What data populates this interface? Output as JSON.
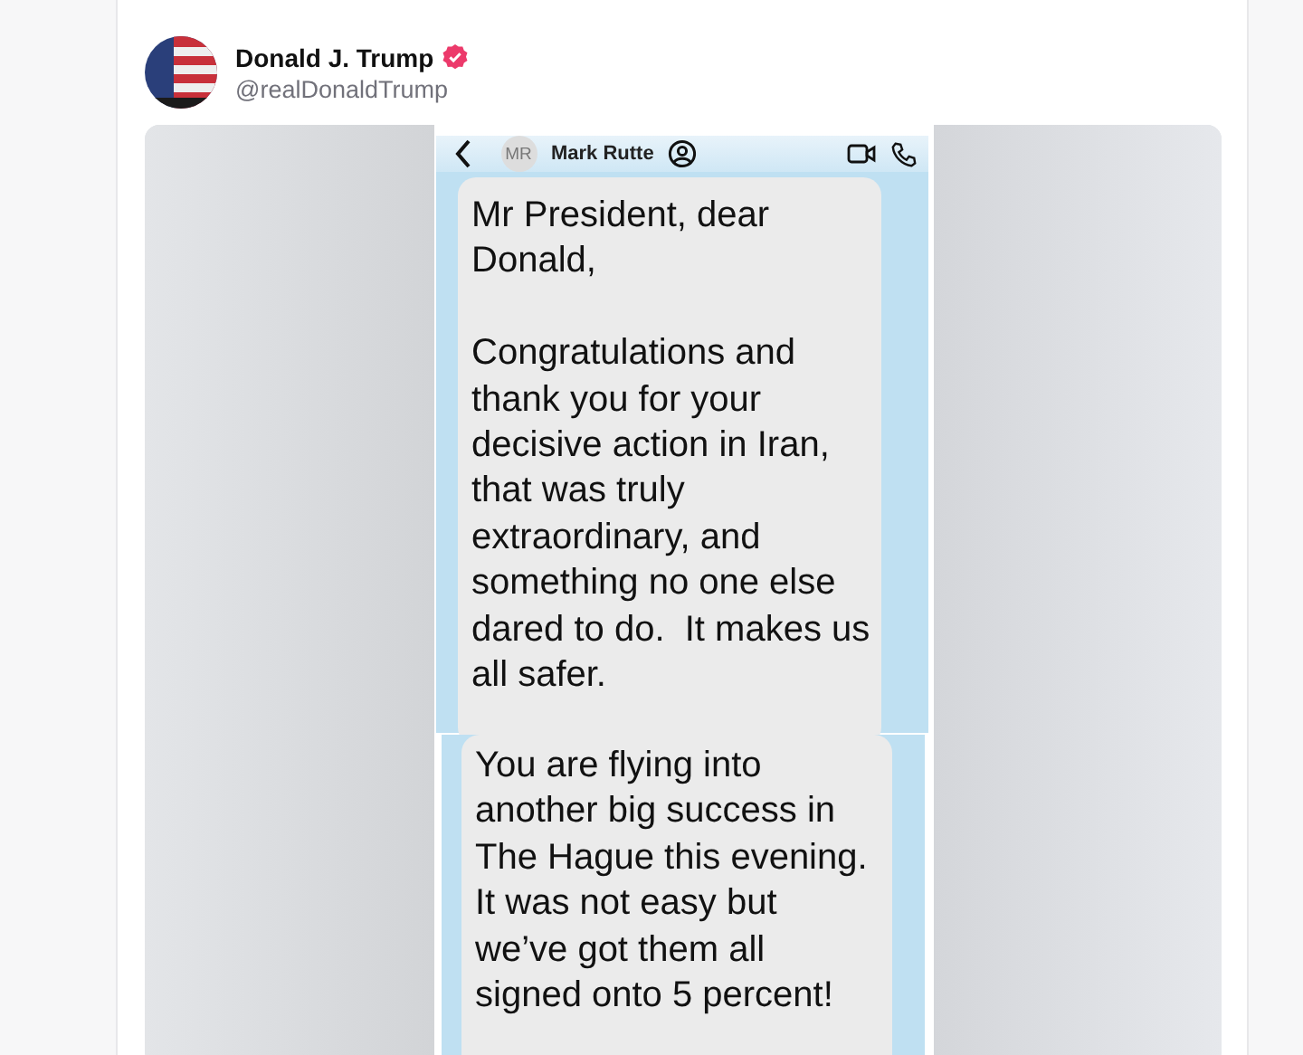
{
  "post": {
    "author": "Donald J. Trump",
    "verified": true,
    "handle": "@realDonaldTrump"
  },
  "chat_header": {
    "initials": "MR",
    "contact": "Mark Rutte"
  },
  "messages": [
    {
      "paragraphs": [
        "Mr President, dear\nDonald,",
        "Congratulations and\nthank you for your\ndecisive action in Iran,\nthat was truly\nextraordinary, and\nsomething no one else\ndared to do.  It makes us\nall safer."
      ]
    },
    {
      "paragraphs": [
        "You are flying into\nanother big success in\nThe Hague this evening.\nIt was not easy but\nwe’ve got them all\nsigned onto 5 percent!"
      ]
    }
  ]
}
